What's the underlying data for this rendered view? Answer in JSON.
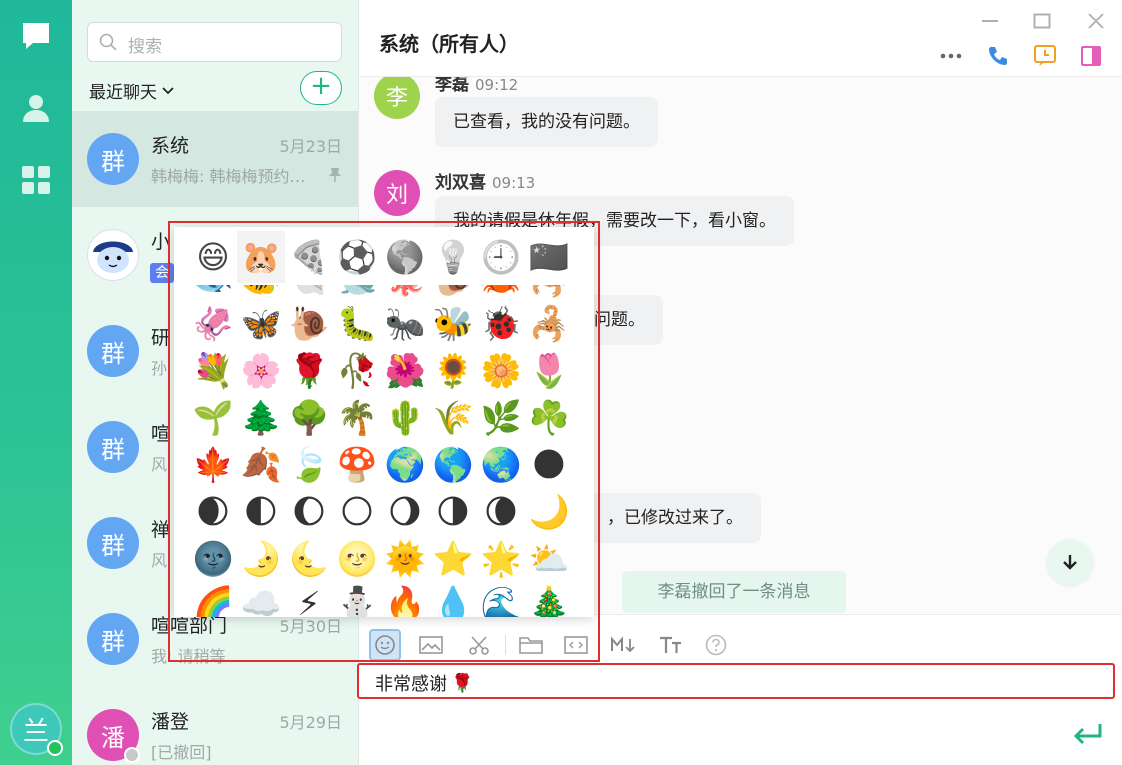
{
  "search": {
    "placeholder": "搜索"
  },
  "list": {
    "header_label": "最近聊天",
    "conversations": [
      {
        "avatar": "群",
        "name": "系统",
        "date": "5月23日",
        "preview": "韩梅梅: 韩梅梅预约…",
        "color": "#63a6f2"
      },
      {
        "avatar": "",
        "name": "小",
        "date": "",
        "preview": "",
        "badge": "会",
        "color": "#ffffff"
      },
      {
        "avatar": "群",
        "name": "研",
        "date": "",
        "preview": "孙",
        "color": "#63a6f2"
      },
      {
        "avatar": "群",
        "name": "喧",
        "date": "",
        "preview": "风",
        "color": "#63a6f2"
      },
      {
        "avatar": "群",
        "name": "禅",
        "date": "",
        "preview": "风",
        "color": "#63a6f2"
      },
      {
        "avatar": "群",
        "name": "喧喧部门",
        "date": "5月30日",
        "preview": "我: 请稍等",
        "color": "#63a6f2"
      },
      {
        "avatar": "潘",
        "name": "潘登",
        "date": "5月29日",
        "preview": "[已撤回]",
        "color": "#e04fb4"
      }
    ]
  },
  "user": {
    "avatar": "兰"
  },
  "chat": {
    "title": "系统（所有人）",
    "messages": [
      {
        "avatar": "李",
        "name": "李磊",
        "time": "09:12",
        "text": "已查看，我的没有问题。",
        "color": "#9fd34e"
      },
      {
        "avatar": "刘",
        "name": "刘双喜",
        "time": "09:13",
        "text": "我的请假是休年假，需要改一下，看小窗。",
        "color": "#e04fb4"
      }
    ],
    "partial_bubble_1": "没问题。",
    "partial_bubble_2": "，已修改过来了。",
    "recall_notice": "李磊撤回了一条消息"
  },
  "input": {
    "value": "非常感谢",
    "emoji": "🌹"
  },
  "emoji_picker": {
    "tabs": [
      "😄",
      "🐹",
      "🍕",
      "⚽",
      "🌎",
      "💡",
      "🕘",
      "🇨🇳"
    ],
    "rows": [
      [
        "🐟",
        "🐠",
        "🐚",
        "🐋",
        "🐙",
        "🐌",
        "🦀",
        "🦂"
      ],
      [
        "🦑",
        "🦋",
        "🐌",
        "🐛",
        "🐜",
        "🐝",
        "🐞",
        "🦂"
      ],
      [
        "💐",
        "🌸",
        "🌹",
        "🥀",
        "🌺",
        "🌻",
        "🌼",
        "🌷"
      ],
      [
        "🌱",
        "🌲",
        "🌳",
        "🌴",
        "🌵",
        "🌾",
        "🌿",
        "☘️"
      ],
      [
        "🍁",
        "🍂",
        "🍃",
        "🍄",
        "🌍",
        "🌎",
        "🌏",
        "🌑"
      ],
      [
        "🌒",
        "🌓",
        "🌔",
        "🌕",
        "🌖",
        "🌗",
        "🌘",
        "🌙"
      ],
      [
        "🌚",
        "🌛",
        "🌜",
        "🌝",
        "🌞",
        "⭐",
        "🌟",
        "⛅"
      ],
      [
        "🌈",
        "☁️",
        "⚡",
        "⛄",
        "🔥",
        "💧",
        "🌊",
        "🎄"
      ]
    ]
  },
  "colors": {
    "accent": "#20b582",
    "highlight": "#e02f2f",
    "rail": "#2cc295"
  }
}
